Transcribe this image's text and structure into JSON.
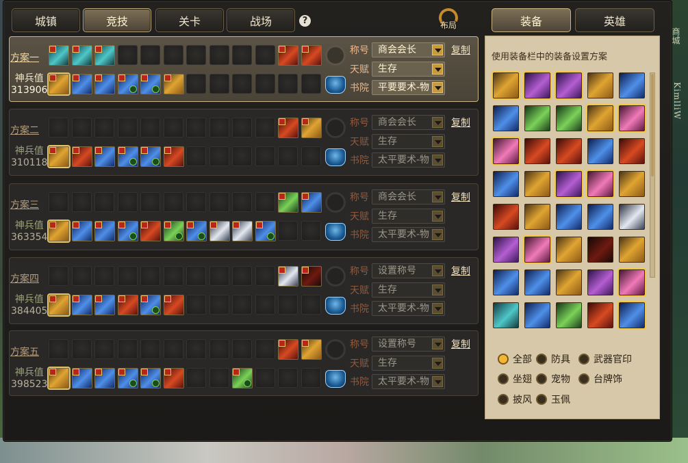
{
  "nav_tabs": [
    "城镇",
    "竞技",
    "关卡",
    "战场"
  ],
  "nav_active": "竞技",
  "help_glyph": "?",
  "layout_button_label": "布局",
  "side_strip_text": [
    "商城",
    "KimlliW"
  ],
  "right_tabs": [
    "装备",
    "英雄"
  ],
  "right_active": "装备",
  "panel_hint": "使用装备栏中的装备设置方案",
  "labels": {
    "title": "称号",
    "talent": "天赋",
    "academy": "书院",
    "power": "神兵值",
    "copy": "复制"
  },
  "schemes": [
    {
      "name": "方案一",
      "power": "313906",
      "title": "商会会长",
      "talent": "生存",
      "academy": "平要要术-物",
      "active": true,
      "row1": [
        "teal",
        "teal",
        "teal",
        "s",
        "s",
        "s",
        "s",
        "s",
        "s",
        "s",
        "red",
        "red"
      ],
      "row2": [
        "gold",
        "blue",
        "blue",
        "blue",
        "blue",
        "gold",
        "s",
        "s",
        "s",
        "s",
        "s",
        "s"
      ]
    },
    {
      "name": "方案二",
      "power": "310118",
      "title": "商会会长",
      "talent": "生存",
      "academy": "太平要术-物",
      "active": false,
      "row1": [
        "s",
        "s",
        "s",
        "s",
        "s",
        "s",
        "s",
        "s",
        "s",
        "s",
        "red",
        "gold"
      ],
      "row2": [
        "gold",
        "red",
        "blue",
        "blue",
        "blue",
        "red",
        "s",
        "s",
        "s",
        "s",
        "s",
        "s"
      ]
    },
    {
      "name": "方案三",
      "power": "363354",
      "title": "商会会长",
      "talent": "生存",
      "academy": "太平要术-物",
      "active": false,
      "row1": [
        "s",
        "s",
        "s",
        "s",
        "s",
        "s",
        "s",
        "s",
        "s",
        "s",
        "green",
        "blue"
      ],
      "row2": [
        "gold",
        "blue",
        "blue",
        "blue",
        "red",
        "green",
        "blue",
        "white",
        "white",
        "blue",
        "s",
        "s"
      ]
    },
    {
      "name": "方案四",
      "power": "384405",
      "title": "设置称号",
      "talent": "生存",
      "academy": "太平要术-物",
      "active": false,
      "row1": [
        "s",
        "s",
        "s",
        "s",
        "s",
        "s",
        "s",
        "s",
        "s",
        "s",
        "white",
        "dark"
      ],
      "row2": [
        "gold",
        "blue",
        "blue",
        "red",
        "blue",
        "red",
        "s",
        "s",
        "s",
        "s",
        "s",
        "s"
      ]
    },
    {
      "name": "方案五",
      "power": "398523",
      "title": "设置称号",
      "talent": "生存",
      "academy": "太平要术-物",
      "active": false,
      "row1": [
        "s",
        "s",
        "s",
        "s",
        "s",
        "s",
        "s",
        "s",
        "s",
        "s",
        "red",
        "gold"
      ],
      "row2": [
        "gold",
        "blue",
        "blue",
        "blue",
        "blue",
        "red",
        "s",
        "s",
        "green",
        "s",
        "s",
        "s"
      ]
    }
  ],
  "inventory": [
    [
      "gold",
      "purple",
      "purple",
      "gold",
      "blue"
    ],
    [
      "blue",
      "green",
      "green",
      "gold",
      "pink"
    ],
    [
      "pink",
      "red",
      "red",
      "blue",
      "red"
    ],
    [
      "blue",
      "gold",
      "purple",
      "pink",
      "gold"
    ],
    [
      "red",
      "gold",
      "blue",
      "blue",
      "white"
    ],
    [
      "purple",
      "pink",
      "gold",
      "dark",
      "gold"
    ],
    [
      "blue",
      "blue",
      "gold",
      "purple",
      "pink"
    ],
    [
      "teal",
      "blue",
      "green",
      "red",
      "blue"
    ]
  ],
  "inventory_glow": [
    [
      0,
      0
    ],
    [
      0,
      1
    ],
    [
      0,
      2
    ],
    [
      1,
      3
    ],
    [
      1,
      4
    ],
    [
      2,
      0
    ],
    [
      3,
      2
    ],
    [
      3,
      3
    ],
    [
      5,
      1
    ],
    [
      6,
      4
    ],
    [
      7,
      4
    ]
  ],
  "filters": [
    {
      "label": "全部",
      "on": true
    },
    {
      "label": "防具",
      "on": false
    },
    {
      "label": "武器官印",
      "on": false
    },
    {
      "label": "坐翅",
      "on": false
    },
    {
      "label": "宠物",
      "on": false
    },
    {
      "label": "台牌饰",
      "on": false
    },
    {
      "label": "披风",
      "on": false
    },
    {
      "label": "玉佩",
      "on": false
    }
  ],
  "colors": {
    "accent": "#c9b487",
    "panel_bg": "#d6c8a8",
    "active_radio": "#f0b634"
  }
}
